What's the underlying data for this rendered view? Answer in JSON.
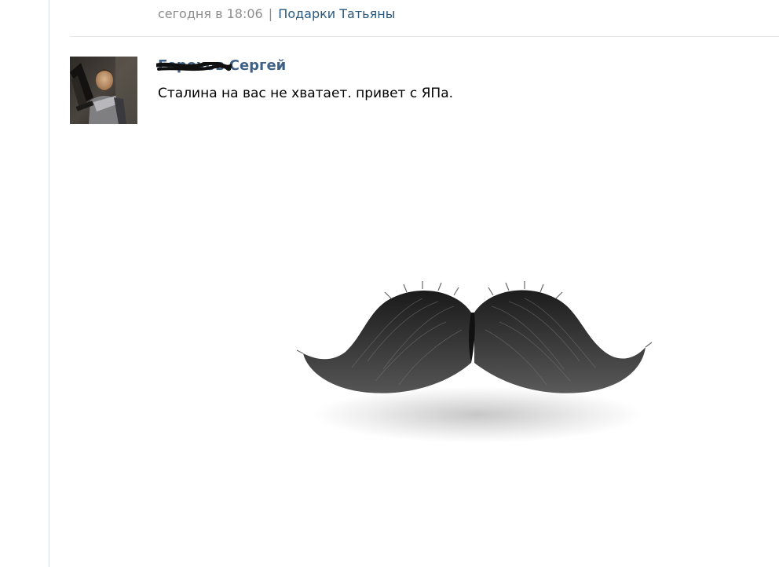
{
  "previous_post": {
    "time": "сегодня в 18:06",
    "separator": "|",
    "gifts_link": "Подарки Татьяны"
  },
  "comment": {
    "author_surname": "Горохов",
    "author_first_name": "Сергей",
    "text": "Сталина на вас не хватает. привет с ЯПа.",
    "attachment_icon": "mustache-image"
  },
  "colors": {
    "link": "#2b587a",
    "author": "#3f6188",
    "meta_gray": "#8d8d8d",
    "divider": "#e4e8ec"
  }
}
